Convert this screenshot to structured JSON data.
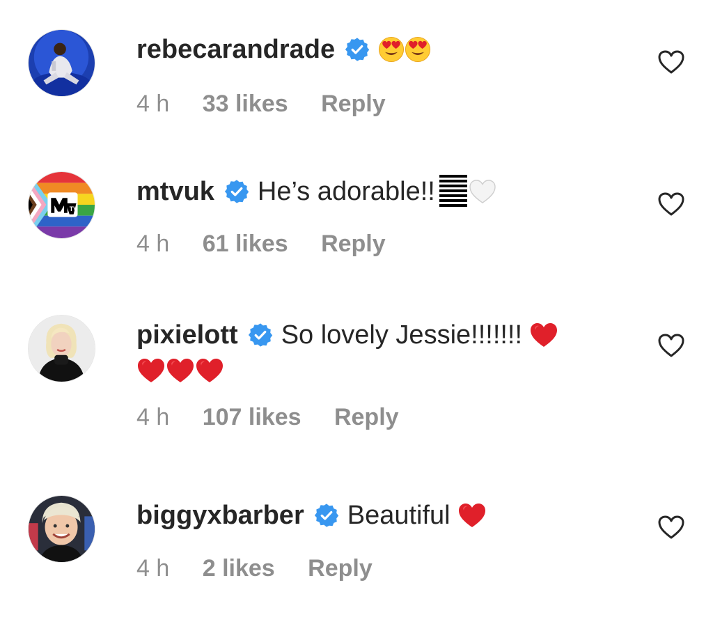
{
  "comments": [
    {
      "username": "rebecarandrade",
      "text": "",
      "emoji": [
        "heart-eyes",
        "heart-eyes"
      ],
      "time": "4 h",
      "likes": "33 likes",
      "reply": "Reply"
    },
    {
      "username": "mtvuk",
      "text": "He’s adorable!! ",
      "emoji": [
        "black-bars",
        "white-heart"
      ],
      "time": "4 h",
      "likes": "61 likes",
      "reply": "Reply"
    },
    {
      "username": "pixielott",
      "text": "So lovely Jessie!!!!!!! ",
      "emoji": [
        "red-heart",
        "red-heart",
        "red-heart",
        "red-heart"
      ],
      "time": "4 h",
      "likes": "107 likes",
      "reply": "Reply"
    },
    {
      "username": "biggyxbarber",
      "text": "Beautiful ",
      "emoji": [
        "red-heart"
      ],
      "time": "4 h",
      "likes": "2 likes",
      "reply": "Reply"
    }
  ],
  "colors": {
    "verified": "#3897f0",
    "meta_gray": "#8e8e8e",
    "text": "#262626",
    "heart_red": "#e0202a"
  },
  "icons": {
    "verified": "verified-badge-icon",
    "like": "heart-outline-icon"
  }
}
